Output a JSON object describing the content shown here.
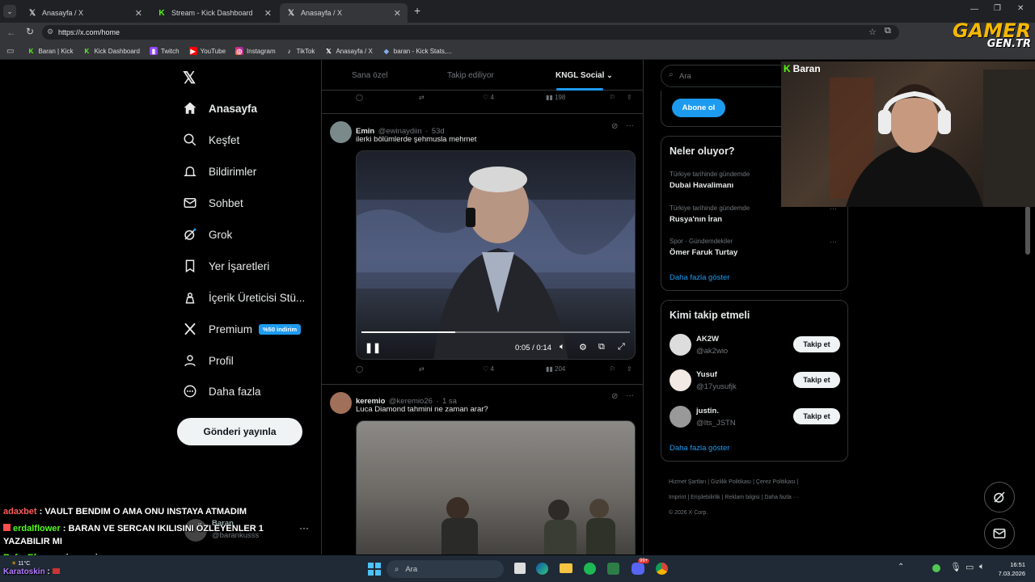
{
  "browser": {
    "tabs": [
      {
        "title": "Anasayfa / X",
        "icon": "x-icon",
        "active": false
      },
      {
        "title": "Stream - Kick Dashboard",
        "icon": "kick-icon",
        "active": false
      },
      {
        "title": "Anasayfa / X",
        "icon": "x-icon",
        "active": true
      }
    ],
    "url": "https://x.com/home",
    "bookmarks": [
      {
        "label": "Baran | Kick",
        "icon": "kick-icon"
      },
      {
        "label": "Kick Dashboard",
        "icon": "kick-icon"
      },
      {
        "label": "Twitch",
        "icon": "twitch-icon"
      },
      {
        "label": "YouTube",
        "icon": "youtube-icon"
      },
      {
        "label": "Instagram",
        "icon": "instagram-icon"
      },
      {
        "label": "TikTok",
        "icon": "tiktok-icon"
      },
      {
        "label": "Anasayfa / X",
        "icon": "x-icon"
      },
      {
        "label": "baran - Kick Stats,...",
        "icon": "stats-icon"
      }
    ]
  },
  "watermark": {
    "line1": "GAMER",
    "line2": "GEN.TR"
  },
  "sidebar": {
    "items": [
      {
        "label": "Anasayfa",
        "icon": "home-icon",
        "bold": true
      },
      {
        "label": "Keşfet",
        "icon": "search-icon"
      },
      {
        "label": "Bildirimler",
        "icon": "bell-icon"
      },
      {
        "label": "Sohbet",
        "icon": "mail-icon"
      },
      {
        "label": "Grok",
        "icon": "grok-icon"
      },
      {
        "label": "Yer İşaretleri",
        "icon": "bookmark-icon"
      },
      {
        "label": "İçerik Üreticisi Stü...",
        "icon": "creator-icon"
      },
      {
        "label": "Premium",
        "icon": "x-premium-icon",
        "badge": "%50 indirim"
      },
      {
        "label": "Profil",
        "icon": "person-icon"
      },
      {
        "label": "Daha fazla",
        "icon": "more-circle-icon"
      }
    ],
    "post_button": "Gönderi yayınla",
    "account": {
      "name": "Baran",
      "handle": "@barankusss"
    }
  },
  "feed": {
    "tabs": [
      "Sana özel",
      "Takip ediliyor",
      "KNGL Social"
    ],
    "top_actions": {
      "likes": "4",
      "views": "198"
    },
    "posts": [
      {
        "name": "Emin",
        "handle": "@ewinaydiin",
        "time": "53d",
        "text": "ilerki bölümlerde şehmusla mehmet",
        "video_time": "0:05 / 0:14",
        "video_progress": 0.35,
        "likes": "4",
        "views": "204"
      },
      {
        "name": "keremio",
        "handle": "@keremio26",
        "time": "1 sa",
        "text": "Luca Diamond tahmini ne zaman arar?"
      }
    ]
  },
  "right": {
    "search_placeholder": "Ara",
    "subscribe_button": "Abone ol",
    "trends_title": "Neler oluyor?",
    "trends": [
      {
        "context": "Türkiye tarihinde gündemde",
        "topic": "Dubai Havalimanı"
      },
      {
        "context": "Türkiye tarihinde gündemde",
        "topic": "Rusya'nın İran"
      },
      {
        "context": "Spor · Gündemdekiler",
        "topic": "Ömer Faruk Turtay"
      }
    ],
    "show_more": "Daha fazla göster",
    "who_title": "Kimi takip etmeli",
    "who": [
      {
        "name": "AK2W",
        "handle": "@ak2wio",
        "button": "Takip et"
      },
      {
        "name": "Yusuf",
        "handle": "@17yusufjk",
        "button": "Takip et"
      },
      {
        "name": "justin.",
        "handle": "@Its_JSTN",
        "button": "Takip et"
      }
    ],
    "who_more": "Daha fazla göster",
    "footer": [
      "Hizmet Şartları",
      "Gizlilik Politikası",
      "Çerez Politikası",
      "Imprint",
      "Erişilebilirlik",
      "Reklam bilgisi",
      "Daha fazla ···",
      "© 2026 X Corp."
    ]
  },
  "webcam": {
    "label": "Baran"
  },
  "chat": [
    {
      "user": "adaxbet",
      "color": "#ff5a5a",
      "msg": "VAULT BENDIM O AMA ONU INSTAYA ATMADIM"
    },
    {
      "user": "erdalflower",
      "color": "#53fc18",
      "msg": "BARAN VE SERCAN IKILISINI ÖZLEYENLER 1 YAZABILIR MI"
    },
    {
      "user": "Rafa_Efe",
      "color": "#53fc18",
      "msg": "rp gircenmi"
    },
    {
      "user": "Karatoskin",
      "color": "#b57cff",
      "msg": ""
    }
  ],
  "taskbar": {
    "weather": "11°C",
    "search": "Ara",
    "time": "16:51",
    "date": "7.03.2026",
    "badge": "99+"
  }
}
